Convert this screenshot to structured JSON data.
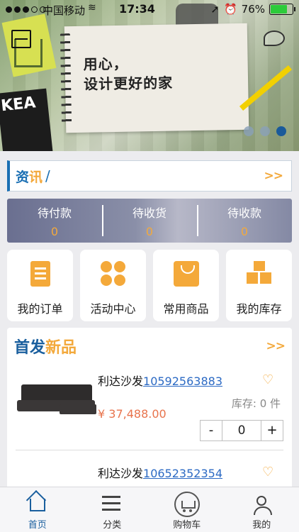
{
  "status_bar": {
    "carrier": "中国移动",
    "time": "17:34",
    "battery": "76%"
  },
  "banner": {
    "slogan_line1": "用心，",
    "slogan_line2": "设计更好的家",
    "book_text": "KEA",
    "page_count": 3,
    "active_page": 3
  },
  "news": {
    "label_part1": "资",
    "label_part2": "讯",
    "slash": "/",
    "more": ">>"
  },
  "orders": [
    {
      "label": "待付款",
      "count": "0"
    },
    {
      "label": "待收货",
      "count": "0"
    },
    {
      "label": "待收款",
      "count": "0"
    }
  ],
  "shortcuts": [
    {
      "label": "我的订单"
    },
    {
      "label": "活动中心"
    },
    {
      "label": "常用商品"
    },
    {
      "label": "我的库存"
    }
  ],
  "new_products": {
    "title_part1": "首发",
    "title_part2": "新品",
    "more": ">>",
    "items": [
      {
        "name": "利达沙发",
        "code": "10592563883",
        "price": "¥ 37,488.00",
        "stock_label": "库存:",
        "stock_value": "0 件",
        "qty": "0",
        "minus": "-",
        "plus": "+"
      },
      {
        "name": "利达沙发",
        "code": "10652352354"
      }
    ]
  },
  "tabbar": [
    {
      "label": "首页",
      "active": true
    },
    {
      "label": "分类",
      "active": false
    },
    {
      "label": "购物车",
      "active": false
    },
    {
      "label": "我的",
      "active": false
    }
  ],
  "colors": {
    "brand_blue": "#1a5f9e",
    "accent_orange": "#f3a93c",
    "price_red": "#e8734c"
  }
}
